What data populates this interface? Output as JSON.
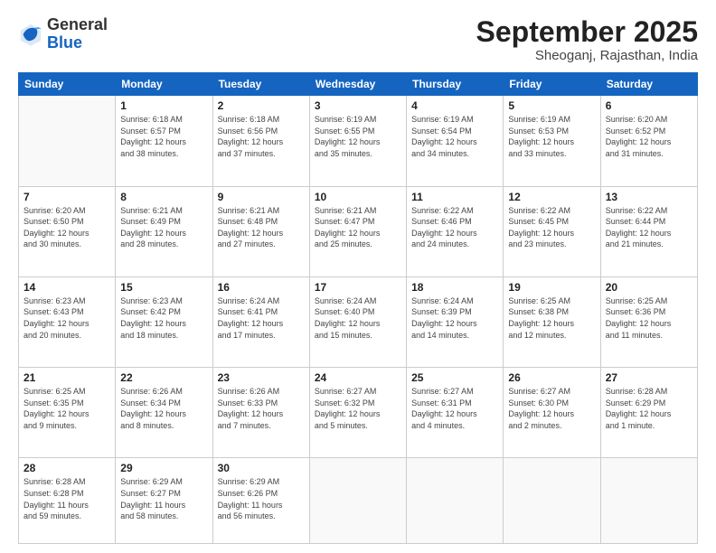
{
  "header": {
    "logo_general": "General",
    "logo_blue": "Blue",
    "month_title": "September 2025",
    "location": "Sheoganj, Rajasthan, India"
  },
  "days_of_week": [
    "Sunday",
    "Monday",
    "Tuesday",
    "Wednesday",
    "Thursday",
    "Friday",
    "Saturday"
  ],
  "weeks": [
    [
      {
        "day": "",
        "info": ""
      },
      {
        "day": "1",
        "info": "Sunrise: 6:18 AM\nSunset: 6:57 PM\nDaylight: 12 hours\nand 38 minutes."
      },
      {
        "day": "2",
        "info": "Sunrise: 6:18 AM\nSunset: 6:56 PM\nDaylight: 12 hours\nand 37 minutes."
      },
      {
        "day": "3",
        "info": "Sunrise: 6:19 AM\nSunset: 6:55 PM\nDaylight: 12 hours\nand 35 minutes."
      },
      {
        "day": "4",
        "info": "Sunrise: 6:19 AM\nSunset: 6:54 PM\nDaylight: 12 hours\nand 34 minutes."
      },
      {
        "day": "5",
        "info": "Sunrise: 6:19 AM\nSunset: 6:53 PM\nDaylight: 12 hours\nand 33 minutes."
      },
      {
        "day": "6",
        "info": "Sunrise: 6:20 AM\nSunset: 6:52 PM\nDaylight: 12 hours\nand 31 minutes."
      }
    ],
    [
      {
        "day": "7",
        "info": "Sunrise: 6:20 AM\nSunset: 6:50 PM\nDaylight: 12 hours\nand 30 minutes."
      },
      {
        "day": "8",
        "info": "Sunrise: 6:21 AM\nSunset: 6:49 PM\nDaylight: 12 hours\nand 28 minutes."
      },
      {
        "day": "9",
        "info": "Sunrise: 6:21 AM\nSunset: 6:48 PM\nDaylight: 12 hours\nand 27 minutes."
      },
      {
        "day": "10",
        "info": "Sunrise: 6:21 AM\nSunset: 6:47 PM\nDaylight: 12 hours\nand 25 minutes."
      },
      {
        "day": "11",
        "info": "Sunrise: 6:22 AM\nSunset: 6:46 PM\nDaylight: 12 hours\nand 24 minutes."
      },
      {
        "day": "12",
        "info": "Sunrise: 6:22 AM\nSunset: 6:45 PM\nDaylight: 12 hours\nand 23 minutes."
      },
      {
        "day": "13",
        "info": "Sunrise: 6:22 AM\nSunset: 6:44 PM\nDaylight: 12 hours\nand 21 minutes."
      }
    ],
    [
      {
        "day": "14",
        "info": "Sunrise: 6:23 AM\nSunset: 6:43 PM\nDaylight: 12 hours\nand 20 minutes."
      },
      {
        "day": "15",
        "info": "Sunrise: 6:23 AM\nSunset: 6:42 PM\nDaylight: 12 hours\nand 18 minutes."
      },
      {
        "day": "16",
        "info": "Sunrise: 6:24 AM\nSunset: 6:41 PM\nDaylight: 12 hours\nand 17 minutes."
      },
      {
        "day": "17",
        "info": "Sunrise: 6:24 AM\nSunset: 6:40 PM\nDaylight: 12 hours\nand 15 minutes."
      },
      {
        "day": "18",
        "info": "Sunrise: 6:24 AM\nSunset: 6:39 PM\nDaylight: 12 hours\nand 14 minutes."
      },
      {
        "day": "19",
        "info": "Sunrise: 6:25 AM\nSunset: 6:38 PM\nDaylight: 12 hours\nand 12 minutes."
      },
      {
        "day": "20",
        "info": "Sunrise: 6:25 AM\nSunset: 6:36 PM\nDaylight: 12 hours\nand 11 minutes."
      }
    ],
    [
      {
        "day": "21",
        "info": "Sunrise: 6:25 AM\nSunset: 6:35 PM\nDaylight: 12 hours\nand 9 minutes."
      },
      {
        "day": "22",
        "info": "Sunrise: 6:26 AM\nSunset: 6:34 PM\nDaylight: 12 hours\nand 8 minutes."
      },
      {
        "day": "23",
        "info": "Sunrise: 6:26 AM\nSunset: 6:33 PM\nDaylight: 12 hours\nand 7 minutes."
      },
      {
        "day": "24",
        "info": "Sunrise: 6:27 AM\nSunset: 6:32 PM\nDaylight: 12 hours\nand 5 minutes."
      },
      {
        "day": "25",
        "info": "Sunrise: 6:27 AM\nSunset: 6:31 PM\nDaylight: 12 hours\nand 4 minutes."
      },
      {
        "day": "26",
        "info": "Sunrise: 6:27 AM\nSunset: 6:30 PM\nDaylight: 12 hours\nand 2 minutes."
      },
      {
        "day": "27",
        "info": "Sunrise: 6:28 AM\nSunset: 6:29 PM\nDaylight: 12 hours\nand 1 minute."
      }
    ],
    [
      {
        "day": "28",
        "info": "Sunrise: 6:28 AM\nSunset: 6:28 PM\nDaylight: 11 hours\nand 59 minutes."
      },
      {
        "day": "29",
        "info": "Sunrise: 6:29 AM\nSunset: 6:27 PM\nDaylight: 11 hours\nand 58 minutes."
      },
      {
        "day": "30",
        "info": "Sunrise: 6:29 AM\nSunset: 6:26 PM\nDaylight: 11 hours\nand 56 minutes."
      },
      {
        "day": "",
        "info": ""
      },
      {
        "day": "",
        "info": ""
      },
      {
        "day": "",
        "info": ""
      },
      {
        "day": "",
        "info": ""
      }
    ]
  ]
}
